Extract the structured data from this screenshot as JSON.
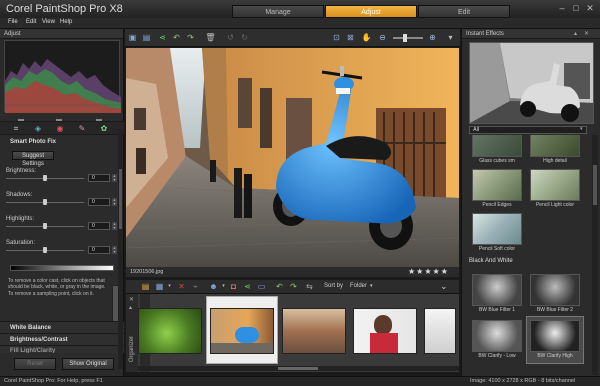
{
  "window": {
    "title": "Corel PaintShop Pro X8",
    "tabs": [
      "Manage",
      "Adjust",
      "Edit"
    ],
    "active_tab": "Adjust"
  },
  "menu": [
    "File",
    "Edit",
    "View",
    "Help"
  ],
  "left_panel": {
    "header": "Adjust",
    "smart_photo_fix": {
      "title": "Smart Photo Fix",
      "suggest_button": "Suggest Settings",
      "sliders": [
        {
          "label": "Brightness:",
          "value": "0",
          "level": 0.5
        },
        {
          "label": "Shadows:",
          "value": "0",
          "level": 0.5
        },
        {
          "label": "Highlights:",
          "value": "0",
          "level": 0.5
        },
        {
          "label": "Saturation:",
          "value": "0",
          "level": 0.5
        }
      ],
      "hint": "To remove a color cast, click on objects that should be black, white, or gray in the image. To remove a sampling point, click on it.",
      "reset_button": "Reset",
      "show_original_button": "Show Original"
    },
    "sections": [
      "White Balance",
      "Brightness/Contrast",
      "Fill Light/Clarity"
    ]
  },
  "photo": {
    "filename": "19201506.jpg",
    "rating_stars": "★★★★★"
  },
  "organizer": {
    "side_label": "Organizer",
    "sort_label": "Sort by",
    "sort_value": "Folder"
  },
  "right_panel": {
    "header": "Instant Effects",
    "category": "All",
    "effects_top": [
      {
        "label": "Glass cubes sm"
      },
      {
        "label": "High detail"
      },
      {
        "label": "Pencil Edges"
      },
      {
        "label": "Pencil Light color"
      },
      {
        "label": "Pencil Soft color"
      }
    ],
    "group_label": "Black And White",
    "effects_bw": [
      {
        "label": "BW Blue Filter 1"
      },
      {
        "label": "BW Blue Filter 2"
      },
      {
        "label": "BW Clarify - Low"
      },
      {
        "label": "BW Clarify High"
      }
    ]
  },
  "status": {
    "left": "Corel PaintShop Pro: For Help, press F1",
    "right": "Image:  4100 x 2728 x RGB - 8 bits/channel"
  },
  "colors": {
    "accent": "#f0a938",
    "scooter": "#2f8fe0",
    "wall": "#e2a450"
  }
}
